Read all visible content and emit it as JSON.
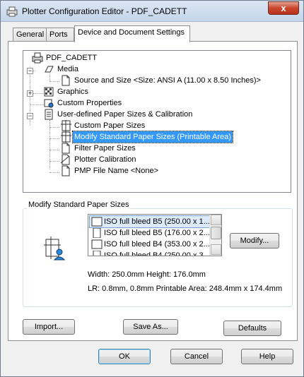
{
  "window": {
    "title": "Plotter Configuration Editor - PDF_CADETT",
    "close_glyph": "x"
  },
  "tabs": [
    {
      "label": "General"
    },
    {
      "label": "Ports"
    },
    {
      "label": "Device and Document Settings"
    }
  ],
  "tree": {
    "root": "PDF_CADETT",
    "media": "Media",
    "source_size": "Source and Size <Size: ANSI A (11.00 x 8.50 Inches)>",
    "graphics": "Graphics",
    "custom_properties": "Custom Properties",
    "user_defined": "User-defined Paper Sizes & Calibration",
    "custom_paper_sizes": "Custom Paper Sizes",
    "modify_standard": "Modify Standard Paper Sizes (Printable Area)",
    "filter_paper": "Filter Paper Sizes",
    "plotter_calibration": "Plotter Calibration",
    "pmp_file": "PMP File Name <None>"
  },
  "group": {
    "title": "Modify Standard Paper Sizes",
    "list_items": [
      "ISO full bleed B5 (250.00 x 1...",
      "ISO full bleed B5 (176.00 x 2...",
      "ISO full bleed B4 (353.00 x 2...",
      "ISO full bleed B4 (250.00 x 3..."
    ],
    "modify_button": "Modify...",
    "size_info": "Width: 250.0mm Height: 176.0mm",
    "area_info": "LR: 0.8mm, 0.8mm  Printable Area: 248.4mm x 174.4mm"
  },
  "buttons": {
    "import": "Import...",
    "save_as": "Save As...",
    "defaults": "Defaults",
    "ok": "OK",
    "cancel": "Cancel",
    "help": "Help"
  },
  "colors": {
    "selection": "#3399ff",
    "close": "#c9462c"
  }
}
